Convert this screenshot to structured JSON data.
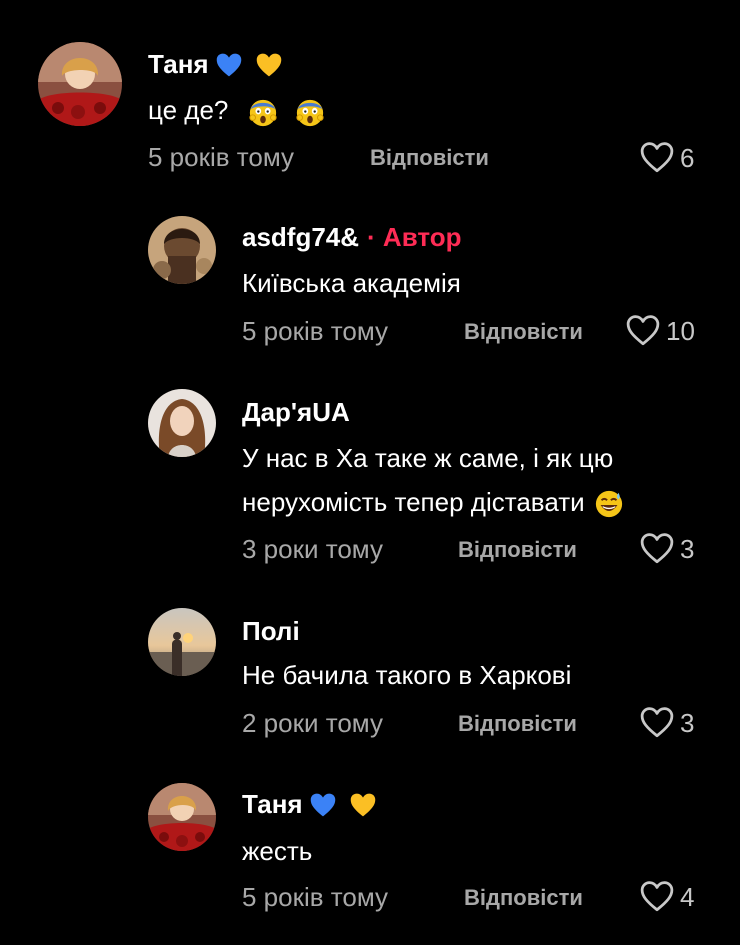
{
  "comments": [
    {
      "user": "Таня",
      "user_emojis": [
        "blue-heart",
        "yellow-heart"
      ],
      "text": "це де?",
      "text_emojis": [
        "scream-face",
        "scream-face"
      ],
      "time": "5 років тому",
      "reply_label": "Відповісти",
      "likes": "6"
    },
    {
      "user": "asdfg74&",
      "author_tag": "· Автор",
      "text": "Київська академія",
      "time": "5 років тому",
      "reply_label": "Відповісти",
      "likes": "10"
    },
    {
      "user": "Дар'яUA",
      "text_line1": "У нас в Ха таке ж саме, і як цю",
      "text_line2": "нерухомість тепер діставати",
      "text_emojis": [
        "sweat-smile-face"
      ],
      "time": "3 роки тому",
      "reply_label": "Відповісти",
      "likes": "3"
    },
    {
      "user": "Полі",
      "text": "Не бачила такого в Харкові",
      "time": "2 роки тому",
      "reply_label": "Відповісти",
      "likes": "3"
    },
    {
      "user": "Таня",
      "user_emojis": [
        "blue-heart",
        "yellow-heart"
      ],
      "text": "жесть",
      "time": "5 років тому",
      "reply_label": "Відповісти",
      "likes": "4"
    }
  ],
  "colors": {
    "background": "#000000",
    "author_tag": "#fe2c55",
    "meta_text": "#a8a8a8"
  }
}
